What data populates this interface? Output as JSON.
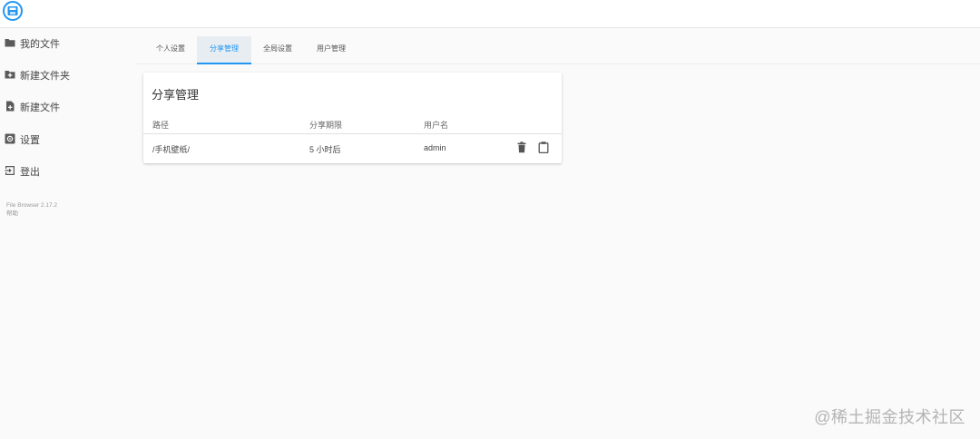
{
  "app": {
    "logo_icon": "file-browser-logo-icon",
    "accent_color": "#2196f3"
  },
  "sidebar": {
    "items": [
      {
        "label": "我的文件",
        "icon": "folder-icon"
      },
      {
        "label": "新建文件夹",
        "icon": "create-folder-icon"
      },
      {
        "label": "新建文件",
        "icon": "note-add-icon"
      },
      {
        "label": "设置",
        "icon": "settings-icon"
      },
      {
        "label": "登出",
        "icon": "exit-icon"
      }
    ],
    "version": "File Browser 2.17.2",
    "help": "帮助"
  },
  "tabs": [
    {
      "label": "个人设置"
    },
    {
      "label": "分享管理",
      "active": true
    },
    {
      "label": "全局设置"
    },
    {
      "label": "用户管理"
    }
  ],
  "card": {
    "title": "分享管理",
    "columns": [
      "路径",
      "分享期限",
      "用户名"
    ],
    "rows": [
      {
        "path": "/手机壁纸/",
        "expire": "5 小时后",
        "user": "admin"
      }
    ],
    "delete_icon": "delete-icon",
    "copy_icon": "clipboard-icon"
  },
  "watermark": "@稀土掘金技术社区"
}
